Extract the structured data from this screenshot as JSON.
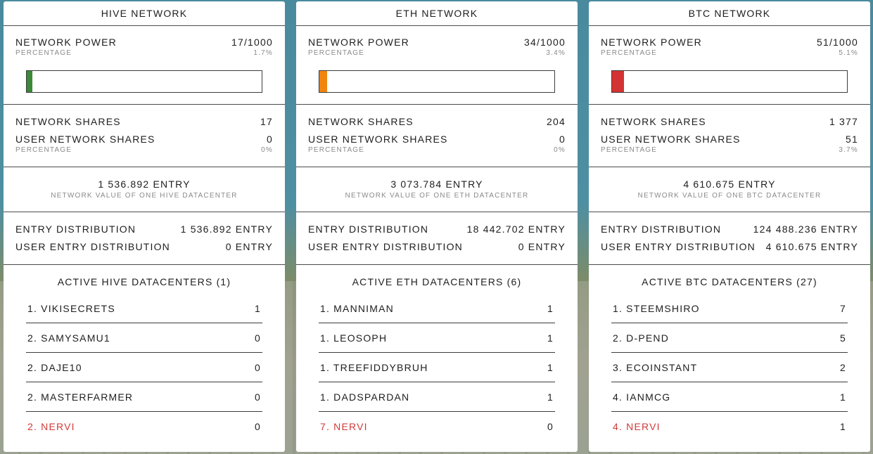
{
  "colors": {
    "hive": "#3a8a3a",
    "eth": "#f0860f",
    "btc": "#d43333",
    "highlight": "#d03a3a"
  },
  "labels": {
    "network_power": "NETWORK POWER",
    "percentage": "PERCENTAGE",
    "network_shares": "NETWORK SHARES",
    "user_network_shares": "USER NETWORK SHARES",
    "entry_distribution": "ENTRY DISTRIBUTION",
    "user_entry_distribution": "USER ENTRY DISTRIBUTION"
  },
  "networks": [
    {
      "title": "HIVE NETWORK",
      "power": "17/1000",
      "power_pct": "1.7%",
      "power_fraction": 0.017,
      "shares": "17",
      "user_shares": "0",
      "user_shares_pct": "0%",
      "value": "1 536.892 ENTRY",
      "value_label": "NETWORK VALUE OF ONE HIVE DATACENTER",
      "distribution": "1 536.892 ENTRY",
      "user_distribution": "0 ENTRY",
      "active_title": "ACTIVE HIVE DATACENTERS (1)",
      "datacenters": [
        {
          "name": "1. VIKISECRETS",
          "count": "1"
        },
        {
          "name": "2. SAMYSAMU1",
          "count": "0"
        },
        {
          "name": "2. DAJE10",
          "count": "0"
        },
        {
          "name": "2. MASTERFARMER",
          "count": "0"
        },
        {
          "name": "2. NERVI",
          "count": "0"
        }
      ]
    },
    {
      "title": "ETH NETWORK",
      "power": "34/1000",
      "power_pct": "3.4%",
      "power_fraction": 0.034,
      "shares": "204",
      "user_shares": "0",
      "user_shares_pct": "0%",
      "value": "3 073.784 ENTRY",
      "value_label": "NETWORK VALUE OF ONE ETH DATACENTER",
      "distribution": "18 442.702 ENTRY",
      "user_distribution": "0 ENTRY",
      "active_title": "ACTIVE ETH DATACENTERS (6)",
      "datacenters": [
        {
          "name": "1. MANNIMAN",
          "count": "1"
        },
        {
          "name": "1. LEOSOPH",
          "count": "1"
        },
        {
          "name": "1. TREEFIDDYBRUH",
          "count": "1"
        },
        {
          "name": "1. DADSPARDAN",
          "count": "1"
        },
        {
          "name": "7. NERVI",
          "count": "0"
        }
      ]
    },
    {
      "title": "BTC NETWORK",
      "power": "51/1000",
      "power_pct": "5.1%",
      "power_fraction": 0.051,
      "shares": "1 377",
      "user_shares": "51",
      "user_shares_pct": "3.7%",
      "value": "4 610.675 ENTRY",
      "value_label": "NETWORK VALUE OF ONE BTC DATACENTER",
      "distribution": "124 488.236 ENTRY",
      "user_distribution": "4 610.675 ENTRY",
      "active_title": "ACTIVE BTC DATACENTERS (27)",
      "datacenters": [
        {
          "name": "1. STEEMSHIRO",
          "count": "7"
        },
        {
          "name": "2. D-PEND",
          "count": "5"
        },
        {
          "name": "3. ECOINSTANT",
          "count": "2"
        },
        {
          "name": "4. IANMCG",
          "count": "1"
        },
        {
          "name": "4. NERVI",
          "count": "1"
        }
      ]
    }
  ]
}
